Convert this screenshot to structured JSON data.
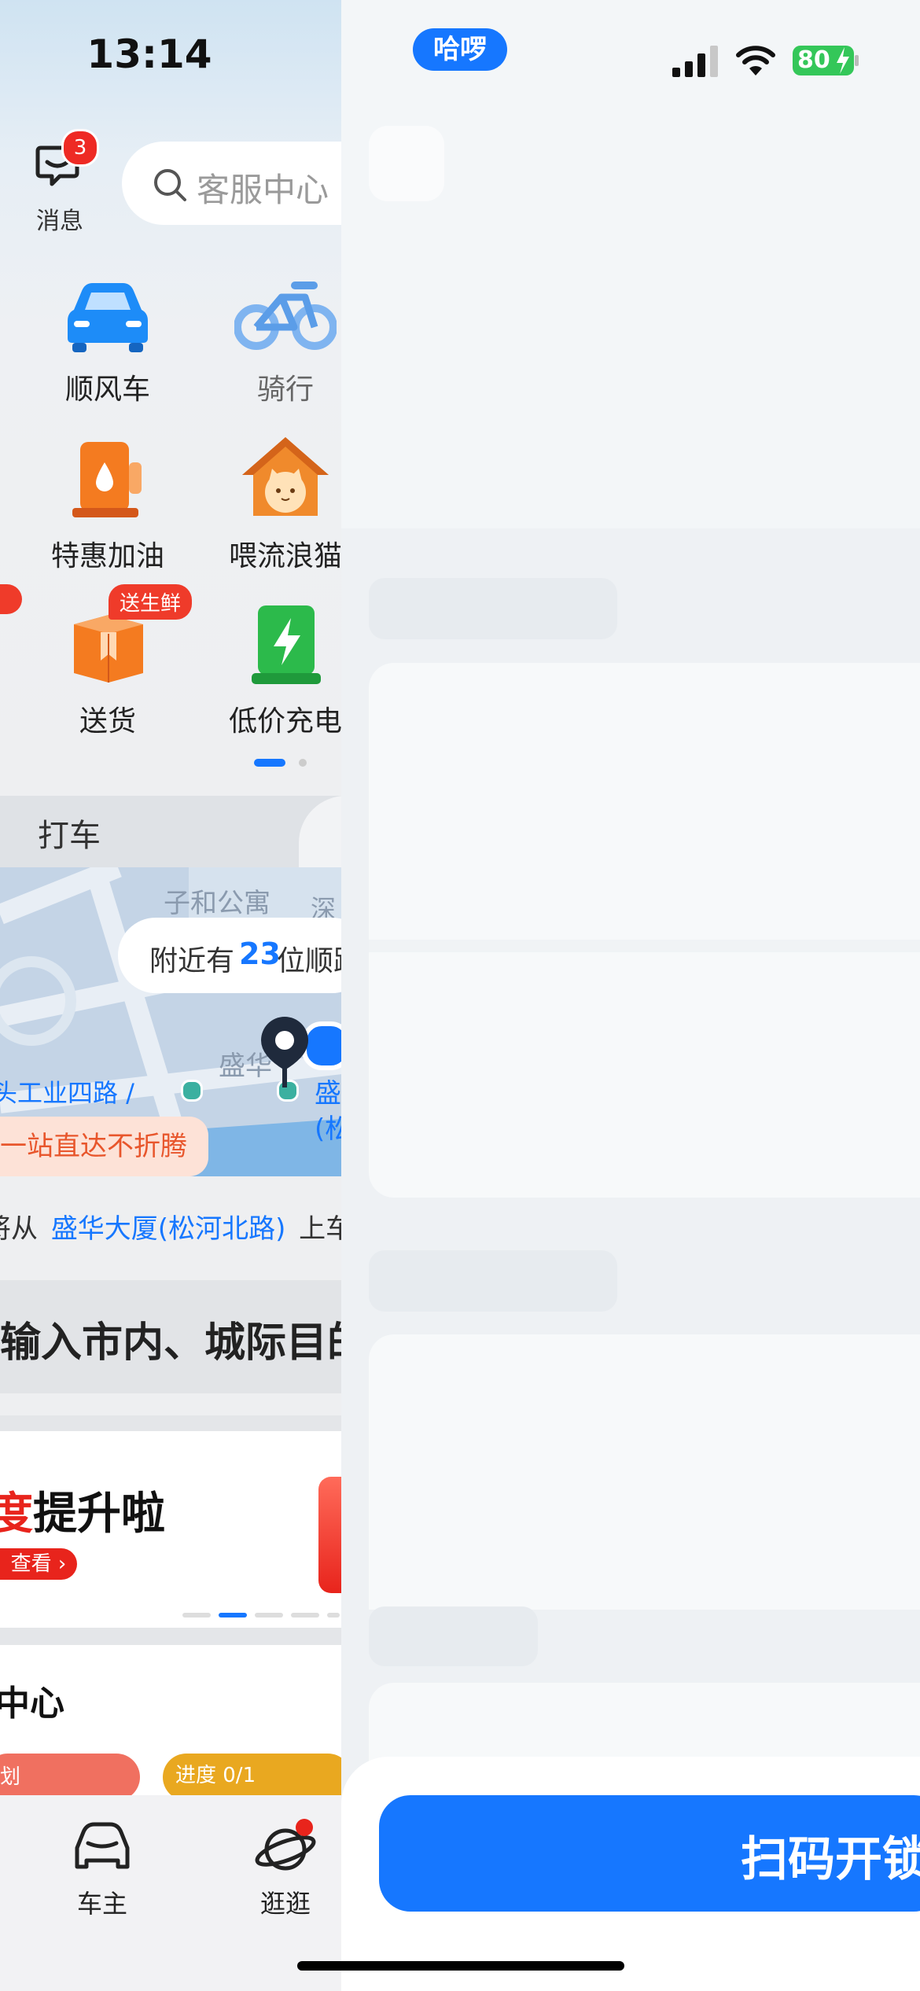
{
  "status_bar": {
    "time": "13:14",
    "app_pill": "哈啰",
    "battery": "80"
  },
  "header": {
    "message_label": "消息",
    "message_badge": "3",
    "search_placeholder": "客服中心"
  },
  "services": [
    {
      "label": "顺风车",
      "icon": "car-icon"
    },
    {
      "label": "骑行",
      "icon": "bike-icon"
    },
    {
      "label": "特惠加油",
      "icon": "fuel-icon"
    },
    {
      "label": "喂流浪猫",
      "icon": "cat-house-icon"
    },
    {
      "label": "送货",
      "icon": "package-icon",
      "tag": "送生鲜"
    },
    {
      "label": "低价充电",
      "icon": "charging-icon"
    }
  ],
  "tab": {
    "taxi": "打车"
  },
  "map": {
    "poi_1": "子和公寓",
    "poi_2": "深",
    "poi_3": "盛华",
    "road": "头工业四路 /",
    "loc_prefix": "盛",
    "loc_paren": "(松",
    "nearby_prefix": "附近有",
    "nearby_count": "23",
    "nearby_suffix": "位顺路",
    "promo": "一站直达不折腾"
  },
  "pickup": {
    "prefix": "将从",
    "place": "盛华大厦(松河北路)",
    "suffix": "上车"
  },
  "destination": {
    "placeholder": "输入市内、城际目的"
  },
  "banner": {
    "title_red": "度",
    "title": "提升啦",
    "button": "查看"
  },
  "section": {
    "title": "中心",
    "progress": "进度 0/1",
    "left_tag": "划"
  },
  "bottom_nav": [
    {
      "label": "车主",
      "icon": "car-outline-icon"
    },
    {
      "label": "逛逛",
      "icon": "planet-icon"
    }
  ],
  "overlay": {
    "scan_button": "扫码开锁"
  },
  "colors": {
    "brand_blue": "#1677ff",
    "badge_red": "#ee2a24",
    "orange": "#f47b20",
    "green": "#2cba4b"
  }
}
